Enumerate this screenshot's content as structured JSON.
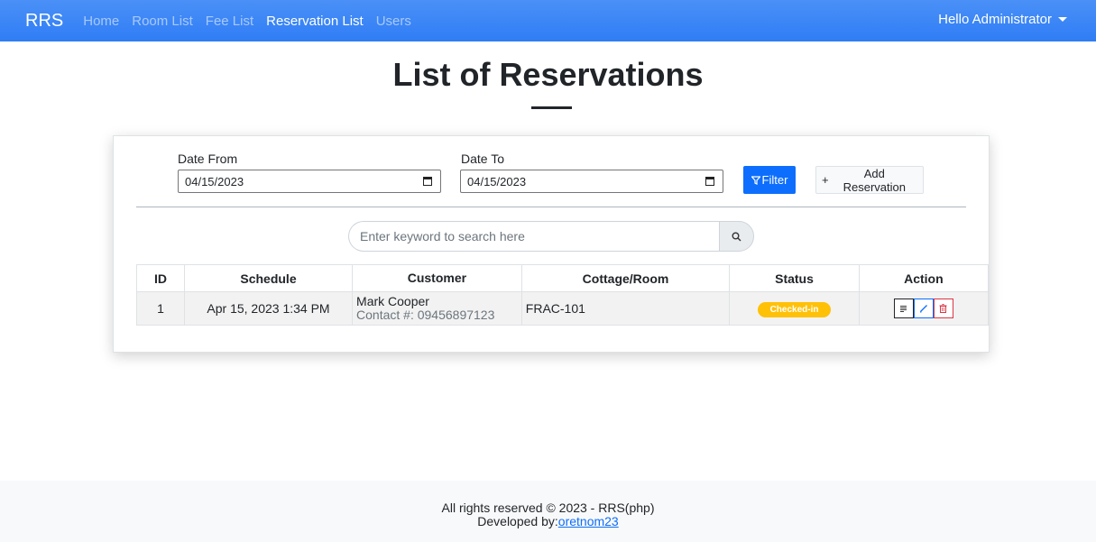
{
  "navbar": {
    "brand": "RRS",
    "links": [
      "Home",
      "Room List",
      "Fee List",
      "Reservation List",
      "Users"
    ],
    "active": "Reservation List",
    "user_greeting": "Hello Administrator"
  },
  "page": {
    "title": "List of Reservations"
  },
  "filters": {
    "date_from_label": "Date From",
    "date_from_value": "04/15/2023",
    "date_to_label": "Date To",
    "date_to_value": "04/15/2023",
    "filter_button": "Filter",
    "add_button": "Add Reservation"
  },
  "search": {
    "placeholder": "Enter keyword to search here"
  },
  "table": {
    "headers": [
      "ID",
      "Schedule",
      "Customer",
      "Cottage/Room",
      "Status",
      "Action"
    ],
    "rows": [
      {
        "id": "1",
        "schedule": "Apr 15, 2023 1:34 PM",
        "customer_name": "Mark Cooper",
        "customer_contact": "Contact #: 09456897123",
        "room": "FRAC-101",
        "status": "Checked-in"
      }
    ]
  },
  "footer": {
    "line1": "All rights reserved © 2023 - RRS(php)",
    "developed_by": "Developed by:",
    "developer": "oretnom23"
  },
  "colors": {
    "navbar": "#3a86f6",
    "primary": "#0d6efd",
    "status_checked_in": "#ffc107",
    "danger": "#dc3545"
  }
}
